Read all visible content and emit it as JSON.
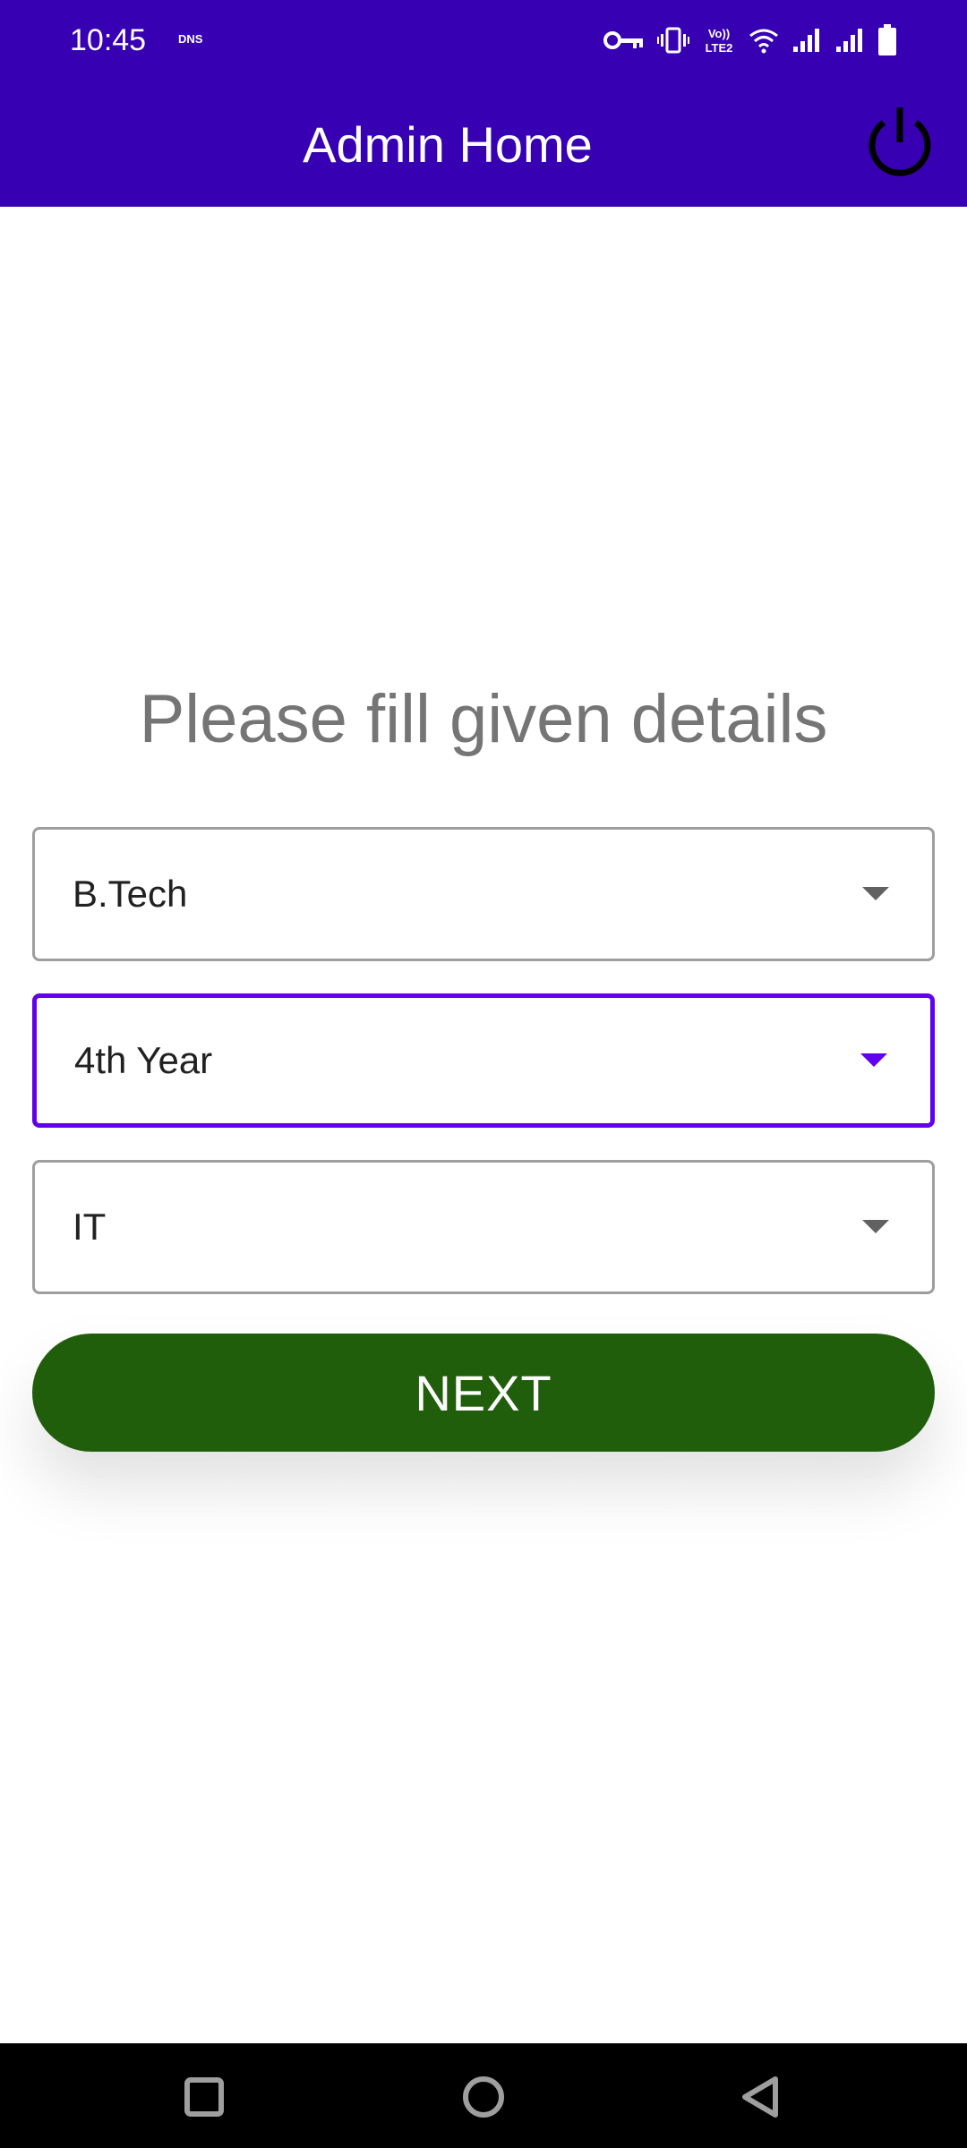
{
  "status_bar": {
    "time": "10:45",
    "dns_label": "DNS",
    "icons": [
      "vpn-key-icon",
      "vibrate-icon",
      "volte-lte2-icon",
      "wifi-icon",
      "signal-1-icon",
      "signal-2-icon",
      "battery-icon"
    ],
    "volte_text_top": "Vo))",
    "volte_text_bottom": "LTE2"
  },
  "app_bar": {
    "title": "Admin Home",
    "power_icon": "power-icon",
    "background_color": "#3700b3"
  },
  "form": {
    "heading": "Please fill given details",
    "course": {
      "selected": "B.Tech"
    },
    "year": {
      "selected": "4th Year",
      "focused": true
    },
    "branch": {
      "selected": "IT"
    },
    "next_label": "NEXT",
    "accent_color": "#6200ee",
    "button_color": "#215e0c"
  },
  "nav_bar": {
    "icons": [
      "recents-square-icon",
      "home-circle-icon",
      "back-triangle-icon"
    ]
  }
}
